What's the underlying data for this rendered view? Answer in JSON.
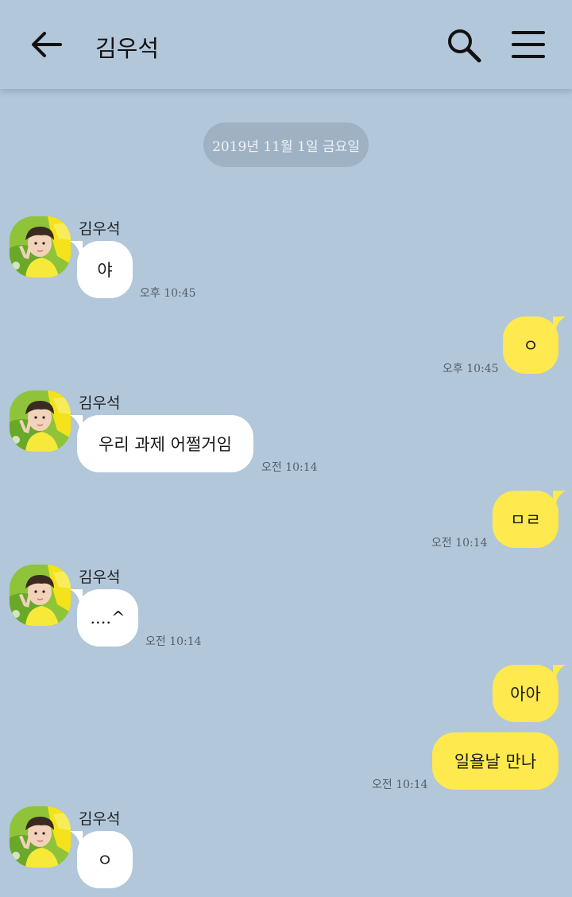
{
  "header": {
    "title": "김우석",
    "back_icon": "arrow-left-icon",
    "search_icon": "search-icon",
    "menu_icon": "hamburger-menu-icon"
  },
  "date_divider": "2019년 11월 1일 금요일",
  "colors": {
    "background": "#b2c7d9",
    "incoming_bubble": "#ffffff",
    "outgoing_bubble": "#fee94e",
    "date_pill": "#9fb2c4"
  },
  "messages": [
    {
      "sender": "김우석",
      "text": "야",
      "time": "오후 10:45",
      "direction": "incoming"
    },
    {
      "text": "ㅇ",
      "time": "오후 10:45",
      "direction": "outgoing"
    },
    {
      "sender": "김우석",
      "text": "우리 과제 어쩔거임",
      "time": "오전 10:14",
      "direction": "incoming"
    },
    {
      "text": "ㅁㄹ",
      "time": "오전 10:14",
      "direction": "outgoing"
    },
    {
      "sender": "김우석",
      "text": "....^",
      "time": "오전 10:14",
      "direction": "incoming"
    },
    {
      "text": "아아",
      "direction": "outgoing"
    },
    {
      "text": "일욜날 만나",
      "time": "오전 10:14",
      "direction": "outgoing"
    },
    {
      "sender": "김우석",
      "text": "ㅇ",
      "direction": "incoming"
    }
  ]
}
